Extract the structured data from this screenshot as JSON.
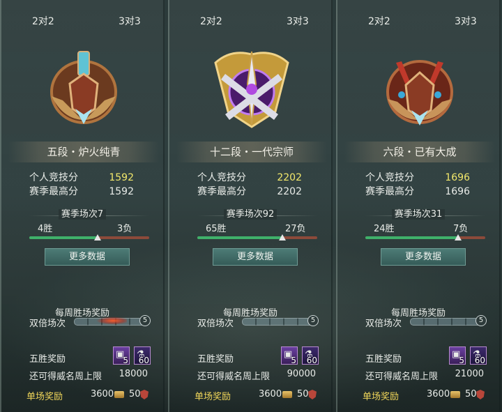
{
  "panels": [
    {
      "mode_2v2": "2对2",
      "mode_3v3": "3对3",
      "rank": "五段・炉火纯青",
      "personal_label": "个人竞技分",
      "personal_score": "1592",
      "season_high_label": "赛季最高分",
      "season_high": "1592",
      "season_matches": "赛季场次7",
      "wins": "4胜",
      "losses": "3负",
      "win_fraction": 0.571,
      "more_data": "更多数据",
      "weekly_title": "每周胜场奖励",
      "double_label": "双倍场次",
      "double_count": "5",
      "five_win_label": "五胜奖励",
      "reward_chest_count": "5",
      "reward_potion_count": "60",
      "cap_label": "还可得威名周上限",
      "cap_value": "18000",
      "single_label": "单场奖励",
      "single_gold": "3600",
      "single_honor": "50",
      "emblem": "bronze-winged-sword-emblem"
    },
    {
      "mode_2v2": "2对2",
      "mode_3v3": "3对3",
      "rank": "十二段・一代宗师",
      "personal_label": "个人竞技分",
      "personal_score": "2202",
      "season_high_label": "赛季最高分",
      "season_high": "2202",
      "season_matches": "赛季场次92",
      "wins": "65胜",
      "losses": "27负",
      "win_fraction": 0.707,
      "more_data": "更多数据",
      "weekly_title": "每周胜场奖励",
      "double_label": "双倍场次",
      "double_count": "5",
      "five_win_label": "五胜奖励",
      "reward_chest_count": "5",
      "reward_potion_count": "60",
      "cap_label": "还可得威名周上限",
      "cap_value": "90000",
      "single_label": "单场奖励",
      "single_gold": "3600",
      "single_honor": "50",
      "emblem": "gold-crossed-swords-emblem"
    },
    {
      "mode_2v2": "2对2",
      "mode_3v3": "3对3",
      "rank": "六段・已有大成",
      "personal_label": "个人竞技分",
      "personal_score": "1696",
      "season_high_label": "赛季最高分",
      "season_high": "1696",
      "season_matches": "赛季场次31",
      "wins": "24胜",
      "losses": "7负",
      "win_fraction": 0.774,
      "more_data": "更多数据",
      "weekly_title": "每周胜场奖励",
      "double_label": "双倍场次",
      "double_count": "5",
      "five_win_label": "五胜奖励",
      "reward_chest_count": "5",
      "reward_potion_count": "60",
      "cap_label": "还可得威名周上限",
      "cap_value": "21000",
      "single_label": "单场奖励",
      "single_gold": "3600",
      "single_honor": "50",
      "emblem": "red-winged-helmet-emblem"
    }
  ],
  "colors": {
    "highlight": "#f3e86b",
    "win": "#3fb16a",
    "loss": "#8c4a3a",
    "button": "#3f6b66",
    "single_reward": "#f0d65a"
  }
}
